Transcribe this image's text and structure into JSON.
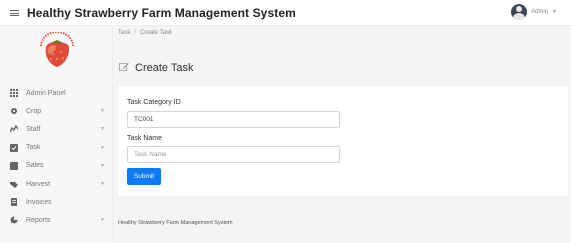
{
  "header": {
    "title": "Healthy Strawberry Farm Management System",
    "user_name": "Admin",
    "menu_icon": "hamburger-icon",
    "user_caret": "chevron-down-icon"
  },
  "sidebar": {
    "logo": "strawberry-logo",
    "items": [
      {
        "label": "Admin Panel",
        "icon": "grid-icon",
        "has_caret": false
      },
      {
        "label": "Crop",
        "icon": "gear-icon",
        "has_caret": true
      },
      {
        "label": "Staff",
        "icon": "staff-icon",
        "has_caret": true
      },
      {
        "label": "Task",
        "icon": "task-icon",
        "has_caret": true
      },
      {
        "label": "Sales",
        "icon": "sales-icon",
        "has_caret": true
      },
      {
        "label": "Harvest",
        "icon": "harvest-icon",
        "has_caret": true
      },
      {
        "label": "Invoices",
        "icon": "invoice-icon",
        "has_caret": false
      },
      {
        "label": "Reports",
        "icon": "reports-icon",
        "has_caret": true
      }
    ]
  },
  "breadcrumb": {
    "items": [
      "Task",
      "Create Task"
    ],
    "separator": "/"
  },
  "page": {
    "title": "Create Task",
    "title_icon": "edit-icon"
  },
  "form": {
    "category_label": "Task Category ID",
    "category_value": "TC001",
    "name_label": "Task Name",
    "name_placeholder": "Task Name",
    "submit_label": "Submit"
  },
  "footer": {
    "text": "Healthy Strawberry Farm Management System"
  },
  "colors": {
    "primary": "#0d7bf5",
    "logo_red": "#e04a3a"
  }
}
